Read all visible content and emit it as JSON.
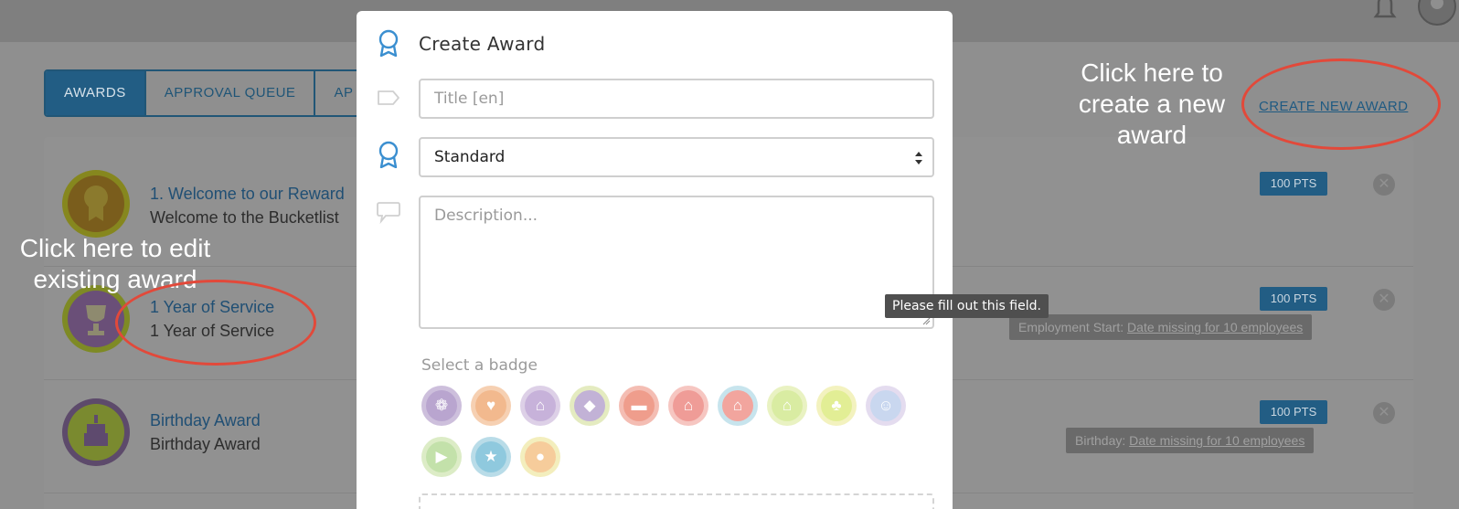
{
  "tabs": [
    {
      "label": "AWARDS"
    },
    {
      "label": "APPROVAL QUEUE"
    },
    {
      "label": "AP"
    }
  ],
  "header": {
    "create_new_award": "CREATE NEW AWARD"
  },
  "awards": [
    {
      "title": "1. Welcome to our Reward",
      "subtitle": "Welcome to the Bucketlist",
      "points": "100 PTS"
    },
    {
      "title": "1 Year of Service",
      "subtitle": "1 Year of Service",
      "points": "100 PTS",
      "status_label": "Employment Start:",
      "status_link": "Date missing for 10 employees"
    },
    {
      "title": "Birthday Award",
      "subtitle": "Birthday Award",
      "points": "100 PTS",
      "status_label": "Birthday:",
      "status_link": "Date missing for 10 employees"
    }
  ],
  "annotations": {
    "create": "Click here to create a new award",
    "edit": "Click here to edit existing award"
  },
  "modal": {
    "title": "Create Award",
    "title_placeholder": "Title [en]",
    "type_value": "Standard",
    "description_placeholder": "Description...",
    "tooltip": "Please fill out this field.",
    "badge_label": "Select a badge",
    "badges": [
      {
        "icon": "trophy-icon",
        "ring": "#cdbfdc",
        "fill": "#b9a5cf"
      },
      {
        "icon": "heart-icon",
        "ring": "#f6d0b2",
        "fill": "#f2b98e"
      },
      {
        "icon": "cake-icon",
        "ring": "#ddd0e7",
        "fill": "#c7b2da"
      },
      {
        "icon": "shield-icon",
        "ring": "#e4ebc0",
        "fill": "#c2b2d6"
      },
      {
        "icon": "speech-bubble-icon",
        "ring": "#f4bdb3",
        "fill": "#ef9d8c"
      },
      {
        "icon": "cake-icon",
        "ring": "#f6c6c1",
        "fill": "#ef9c97"
      },
      {
        "icon": "cupcake-icon",
        "ring": "#c7e4ed",
        "fill": "#f2a59e"
      },
      {
        "icon": "cake-icon",
        "ring": "#e9f2c2",
        "fill": "#d9eca2"
      },
      {
        "icon": "clover-icon",
        "ring": "#f3f2bf",
        "fill": "#e2ee95"
      },
      {
        "icon": "smile-icon",
        "ring": "#e4dcef",
        "fill": "#c9d7ef"
      },
      {
        "icon": "tag-icon",
        "ring": "#dcecc6",
        "fill": "#c3e1aa"
      },
      {
        "icon": "star-icon",
        "ring": "#b9dce8",
        "fill": "#8fc9de"
      },
      {
        "icon": "ribbon-icon",
        "ring": "#f3eebd",
        "fill": "#f6cc9b"
      }
    ]
  }
}
